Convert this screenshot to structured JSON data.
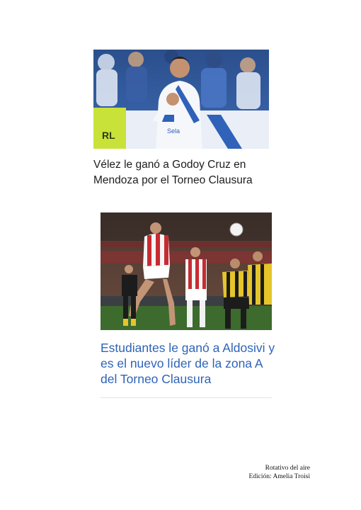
{
  "articles": [
    {
      "headline": "Vélez le ganó a Godoy Cruz en Mendoza por el Torneo Clausura",
      "photo_icon": "football-player-celebration-photo",
      "jersey_text": "Sela",
      "flag_letters": "RL",
      "colors": {
        "headline": "#1d1d1d"
      }
    },
    {
      "headline": "Estudiantes le ganó a Aldosivi y es el nuevo líder de la zona A del Torneo Clausura",
      "photo_icon": "football-header-duel-photo",
      "colors": {
        "headline": "#2e63b8"
      }
    }
  ],
  "footer": {
    "line1": "Rotativo del aire",
    "line2": "Edición: Amelia Troisi"
  }
}
